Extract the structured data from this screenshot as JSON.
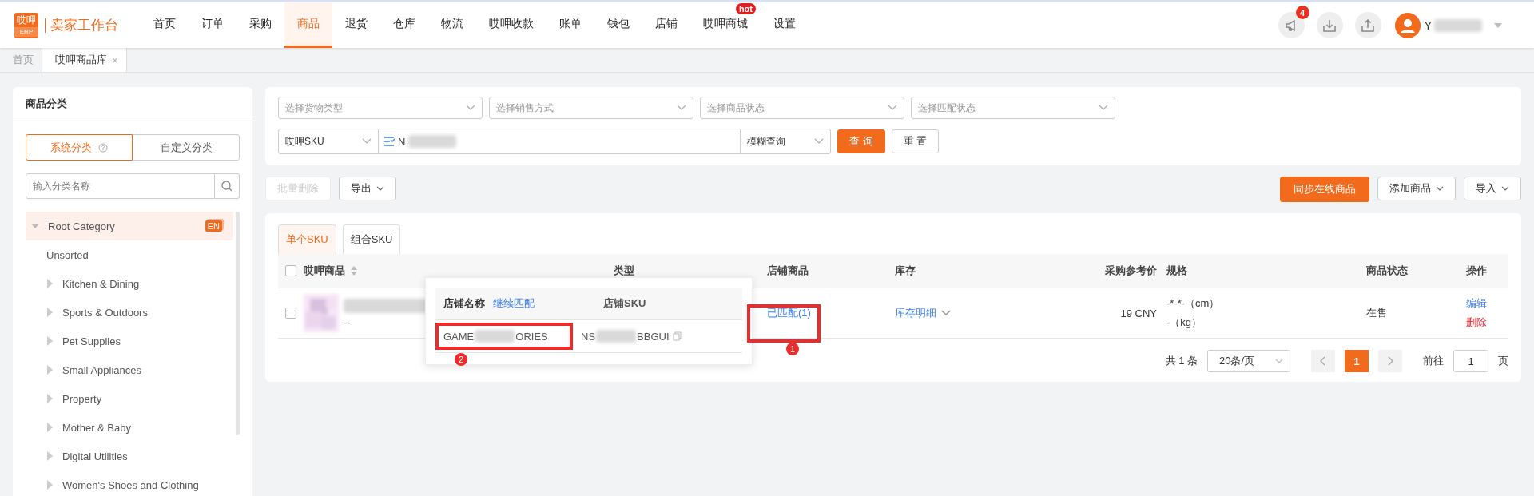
{
  "header": {
    "logo_mark": "哎呷",
    "logo_sub": "ERP",
    "title": "卖家工作台",
    "nav": [
      {
        "label": "首页",
        "selected": false
      },
      {
        "label": "订单",
        "selected": false
      },
      {
        "label": "采购",
        "selected": false
      },
      {
        "label": "商品",
        "selected": true
      },
      {
        "label": "退货",
        "selected": false
      },
      {
        "label": "仓库",
        "selected": false
      },
      {
        "label": "物流",
        "selected": false
      },
      {
        "label": "哎呷收款",
        "selected": false
      },
      {
        "label": "账单",
        "selected": false
      },
      {
        "label": "钱包",
        "selected": false
      },
      {
        "label": "店铺",
        "selected": false
      },
      {
        "label": "哎呷商城",
        "selected": false,
        "badge": "hot"
      },
      {
        "label": "设置",
        "selected": false
      }
    ],
    "notification_count": "4",
    "user": "Y"
  },
  "page_tabs": [
    {
      "label": "首页",
      "selected": false,
      "closable": false
    },
    {
      "label": "哎呷商品库",
      "selected": true,
      "closable": true,
      "close": "×"
    }
  ],
  "sidebar": {
    "title": "商品分类",
    "tabs": [
      {
        "label": "系统分类",
        "selected": true,
        "help": true
      },
      {
        "label": "自定义分类",
        "selected": false,
        "help": false
      }
    ],
    "search_placeholder": "输入分类名称",
    "tree": [
      {
        "label": "Root Category",
        "expanded": true,
        "selected": true,
        "badge": "EN",
        "children": [
          {
            "label": "Unsorted",
            "expandable": false
          },
          {
            "label": "Kitchen & Dining",
            "expandable": true
          },
          {
            "label": "Sports & Outdoors",
            "expandable": true
          },
          {
            "label": "Pet Supplies",
            "expandable": true
          },
          {
            "label": "Small Appliances",
            "expandable": true
          },
          {
            "label": "Property",
            "expandable": true
          },
          {
            "label": "Mother & Baby",
            "expandable": true
          },
          {
            "label": "Digital Utilities",
            "expandable": true
          },
          {
            "label": "Women's Shoes and Clothing",
            "expandable": true
          }
        ]
      }
    ]
  },
  "filters": {
    "selects": [
      {
        "placeholder": "选择货物类型"
      },
      {
        "placeholder": "选择销售方式"
      },
      {
        "placeholder": "选择商品状态"
      },
      {
        "placeholder": "选择匹配状态"
      }
    ],
    "search_type": "哎呷SKU",
    "search_value": "N",
    "match_mode": "模糊查询",
    "query_button": "查 询",
    "reset_button": "重 置"
  },
  "toolbar": {
    "left": [
      {
        "label": "批量删除",
        "disabled": true,
        "dropdown": false
      },
      {
        "label": "导出",
        "disabled": false,
        "dropdown": true
      }
    ],
    "right": [
      {
        "label": "同步在线商品",
        "primary": true,
        "dropdown": false
      },
      {
        "label": "添加商品",
        "primary": false,
        "dropdown": true
      },
      {
        "label": "导入",
        "primary": false,
        "dropdown": true
      }
    ]
  },
  "table": {
    "header_checked": false,
    "tabs": [
      {
        "label": "单个SKU",
        "selected": true
      },
      {
        "label": "组合SKU",
        "selected": false
      }
    ],
    "columns": [
      {
        "label": "哎呷商品",
        "sortable": true
      },
      {
        "label": "类型",
        "sortable": false
      },
      {
        "label": "店铺商品",
        "sortable": false
      },
      {
        "label": "库存",
        "sortable": false
      },
      {
        "label": "采购参考价",
        "sortable": false
      },
      {
        "label": "规格",
        "sortable": false
      },
      {
        "label": "商品状态",
        "sortable": false
      },
      {
        "label": "操作",
        "sortable": false
      }
    ],
    "rows": [
      {
        "checked": false,
        "product_sub": "--",
        "store_products": "已匹配(1)",
        "stock": "库存明细",
        "price": "19 CNY",
        "spec": [
          "-*-*-（cm）",
          "-（kg）"
        ],
        "status": "在售",
        "actions": [
          {
            "label": "编辑",
            "kind": "edit"
          },
          {
            "label": "删除",
            "kind": "delete"
          }
        ]
      }
    ]
  },
  "popup": {
    "columns": [
      {
        "label": "店铺名称",
        "link": "继续匹配"
      },
      {
        "label": "店铺SKU"
      }
    ],
    "rows": [
      {
        "store_name": "GAME",
        "store_name_end": "ORIES",
        "sku": "NS",
        "sku_end": "BBGUI"
      }
    ]
  },
  "pagination": {
    "total": "共 1 条",
    "page_size": "20条/页",
    "pages": [
      {
        "label": "1",
        "selected": true
      }
    ],
    "goto_label": "前往",
    "goto_value": "1",
    "goto_suffix": "页"
  },
  "annotations": [
    {
      "label": "1"
    },
    {
      "label": "2"
    }
  ]
}
